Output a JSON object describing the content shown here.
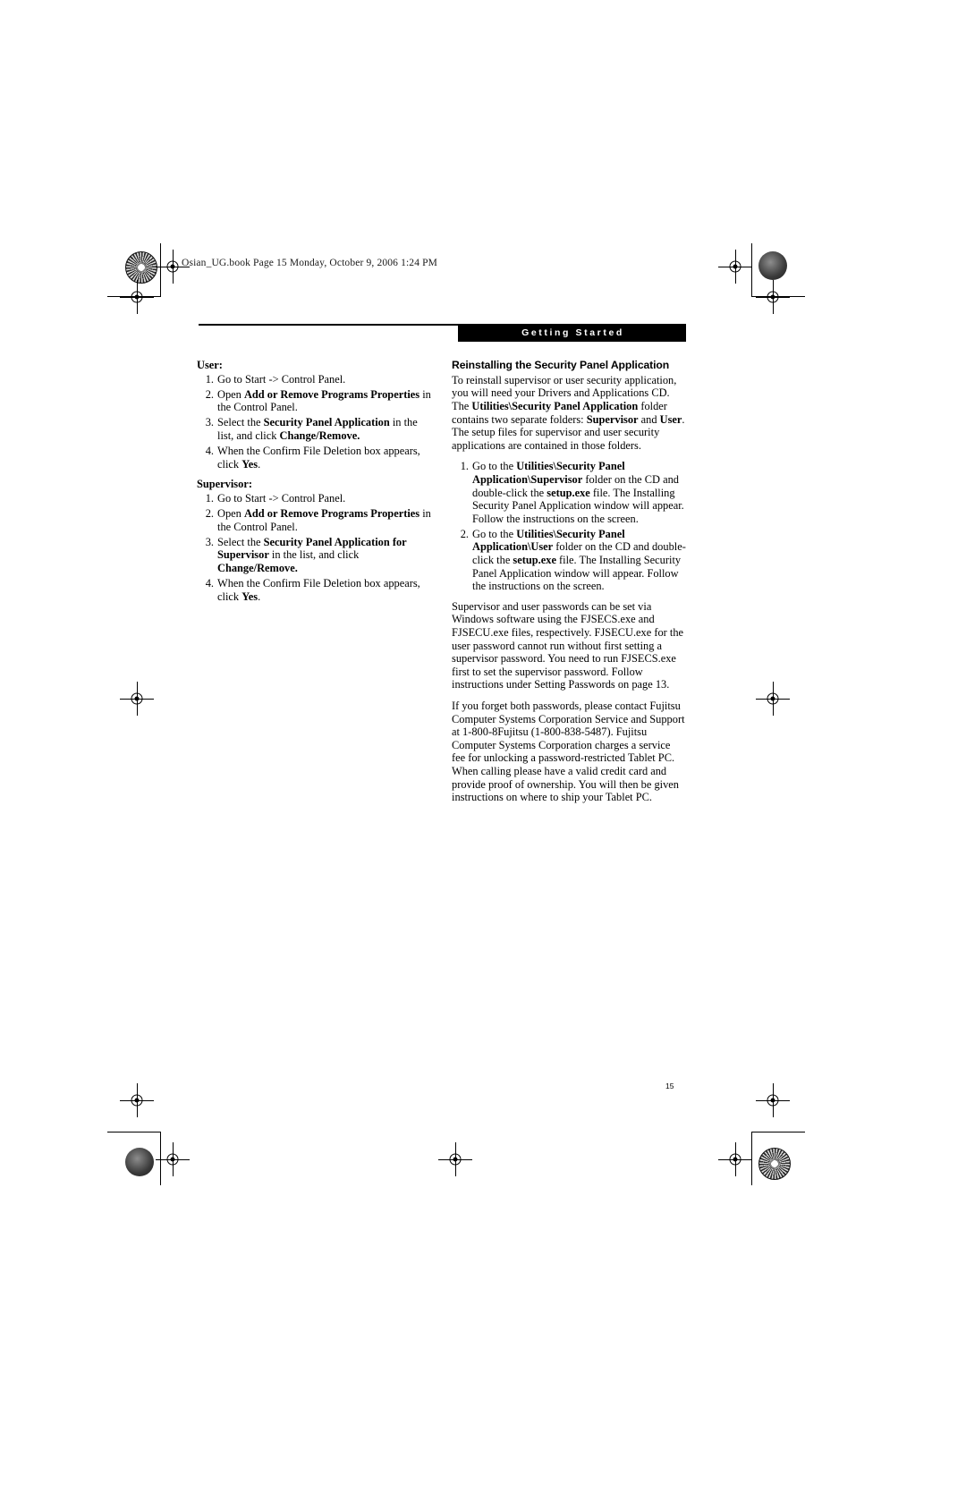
{
  "slug": {
    "text": "Osian_UG.book  Page 15  Monday, October 9, 2006  1:24 PM"
  },
  "header": {
    "section_title": "Getting Started"
  },
  "folio": {
    "page_number": "15"
  },
  "colors": {
    "header_bar_background": "#000000",
    "header_bar_text": "#ffffff",
    "body_text": "#000000",
    "page_background": "#ffffff"
  },
  "left_column": {
    "user": {
      "heading": "User:",
      "steps": [
        {
          "segments": [
            {
              "text": "Go to Start -> Control Panel.",
              "bold": false
            }
          ]
        },
        {
          "segments": [
            {
              "text": "Open ",
              "bold": false
            },
            {
              "text": "Add or Remove Programs Properties",
              "bold": true
            },
            {
              "text": " in the Control Panel.",
              "bold": false
            }
          ]
        },
        {
          "segments": [
            {
              "text": "Select the ",
              "bold": false
            },
            {
              "text": "Security Panel Application",
              "bold": true
            },
            {
              "text": " in the list, and click ",
              "bold": false
            },
            {
              "text": "Change/Remove.",
              "bold": true
            }
          ]
        },
        {
          "segments": [
            {
              "text": "When the Confirm File Deletion box appears, click ",
              "bold": false
            },
            {
              "text": "Yes",
              "bold": true
            },
            {
              "text": ".",
              "bold": false
            }
          ]
        }
      ]
    },
    "supervisor": {
      "heading": "Supervisor:",
      "steps": [
        {
          "segments": [
            {
              "text": "Go to Start -> Control Panel.",
              "bold": false
            }
          ]
        },
        {
          "segments": [
            {
              "text": "Open ",
              "bold": false
            },
            {
              "text": "Add or Remove Programs Properties",
              "bold": true
            },
            {
              "text": " in the Control Panel.",
              "bold": false
            }
          ]
        },
        {
          "segments": [
            {
              "text": "Select the ",
              "bold": false
            },
            {
              "text": "Security Panel Application for Supervisor",
              "bold": true
            },
            {
              "text": " in the list, and click ",
              "bold": false
            },
            {
              "text": "Change/Remove.",
              "bold": true
            }
          ]
        },
        {
          "segments": [
            {
              "text": "When the Confirm File Deletion box appears, click ",
              "bold": false
            },
            {
              "text": "Yes",
              "bold": true
            },
            {
              "text": ".",
              "bold": false
            }
          ]
        }
      ]
    }
  },
  "right_column": {
    "section_heading": "Reinstalling the Security Panel Application",
    "intro_paragraph": {
      "segments": [
        {
          "text": "To reinstall supervisor or user security application, you will need your Drivers and Applications CD. The ",
          "bold": false
        },
        {
          "text": "Utilities\\Security Panel Application",
          "bold": true
        },
        {
          "text": " folder contains two separate folders: ",
          "bold": false
        },
        {
          "text": "Supervisor",
          "bold": true
        },
        {
          "text": " and ",
          "bold": false
        },
        {
          "text": "User",
          "bold": true
        },
        {
          "text": ". The setup files for supervisor and user security applications are contained in those folders.",
          "bold": false
        }
      ]
    },
    "steps": [
      {
        "segments": [
          {
            "text": "Go to the ",
            "bold": false
          },
          {
            "text": "Utilities\\Security Panel Application\\Supervisor",
            "bold": true
          },
          {
            "text": " folder on the CD and double-click the ",
            "bold": false
          },
          {
            "text": "setup.exe",
            "bold": true
          },
          {
            "text": " file. The Installing Security Panel Application window will appear. Follow the instructions on the screen.",
            "bold": false
          }
        ]
      },
      {
        "segments": [
          {
            "text": "Go to the ",
            "bold": false
          },
          {
            "text": "Utilities\\Security Panel Application\\User",
            "bold": true
          },
          {
            "text": " folder on the CD and double-click the ",
            "bold": false
          },
          {
            "text": "setup.exe",
            "bold": true
          },
          {
            "text": " file. The Installing Security Panel Application window will appear. Follow the instructions on the screen.",
            "bold": false
          }
        ]
      }
    ],
    "paragraphs": [
      {
        "segments": [
          {
            "text": "Supervisor and user passwords can be set via Windows software using the FJSECS.exe and FJSECU.exe files, respectively. FJSECU.exe for the user password cannot run without first setting a supervisor password. You need to run FJSECS.exe first to set the supervisor password. Follow instructions under Setting Passwords on page 13.",
            "bold": false
          }
        ]
      },
      {
        "segments": [
          {
            "text": "If you forget both passwords, please contact Fujitsu Computer Systems Corporation Service and Support at 1-800-8Fujitsu (1-800-838-5487). Fujitsu Computer Systems Corporation charges a service fee for unlocking a password-restricted Tablet PC. When calling please have a valid credit card and provide proof of ownership. You will then be given instructions on where to ship your Tablet PC.",
            "bold": false
          }
        ]
      }
    ]
  }
}
